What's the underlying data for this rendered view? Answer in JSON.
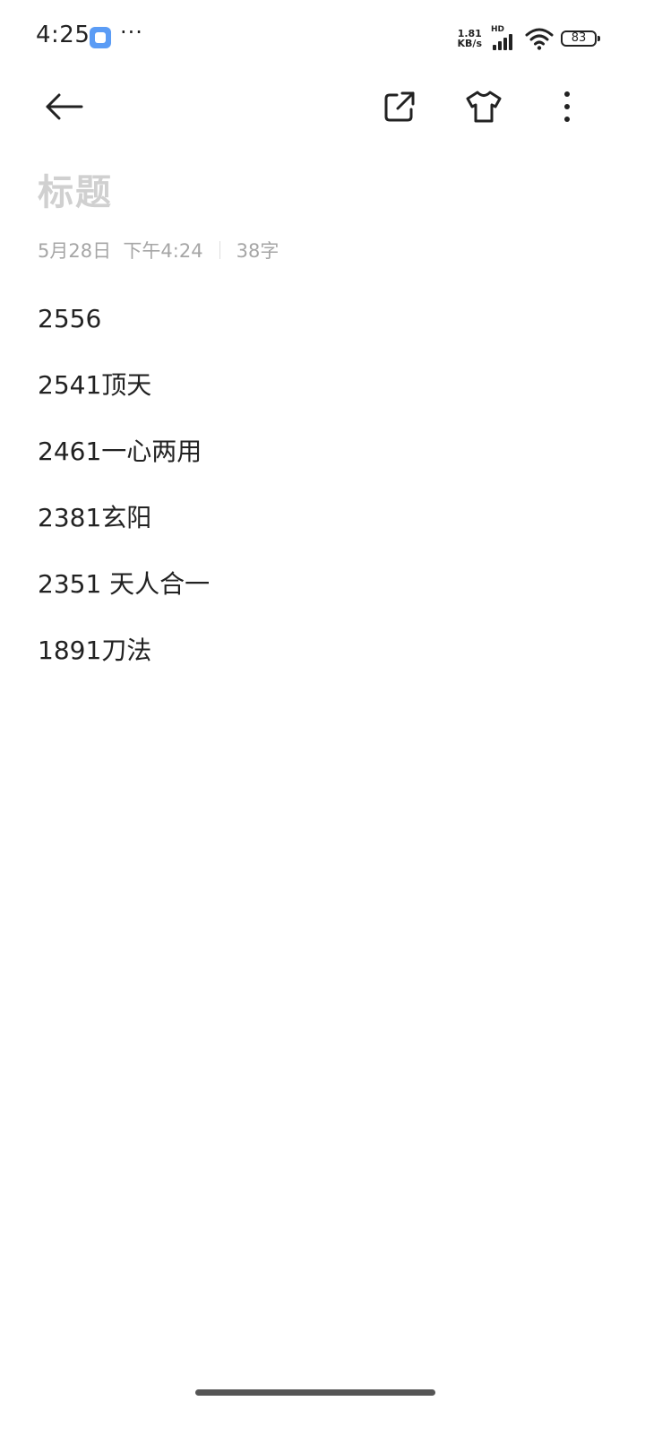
{
  "status_bar": {
    "time": "4:25",
    "more": "···",
    "net_speed_value": "1.81",
    "net_speed_unit": "KB/s",
    "hd_label": "HD",
    "battery_level": "83",
    "app_icon": "notes-app-icon",
    "signal_icon": "cellular-signal-icon",
    "wifi_icon": "wifi-icon",
    "battery_icon": "battery-icon"
  },
  "toolbar": {
    "back_icon": "back-arrow-icon",
    "share_icon": "share-external-icon",
    "theme_icon": "tshirt-theme-icon",
    "more_icon": "more-vertical-icon"
  },
  "note": {
    "title_placeholder": "标题",
    "date": "5月28日  下午4:24",
    "char_count": "38字",
    "lines": [
      "2556",
      "2541顶天",
      "2461一心两用",
      "2381玄阳",
      "2351 天人合一",
      "1891刀法"
    ]
  },
  "colors": {
    "background": "#ffffff",
    "text": "#222222",
    "placeholder": "#d0d0d0",
    "meta": "#a6a6a6",
    "app_icon_blue": "#5b9cf5"
  }
}
